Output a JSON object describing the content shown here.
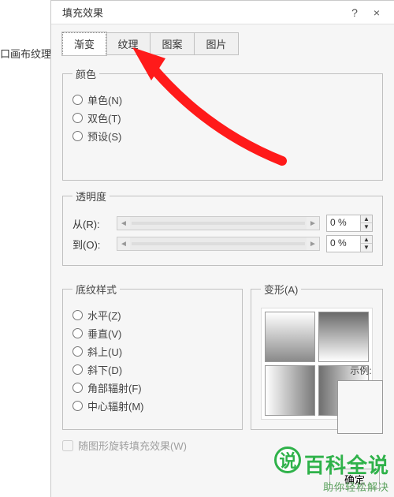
{
  "left_fragment": "口画布纹理的",
  "dialog": {
    "title": "填充效果",
    "help": "?",
    "close": "×"
  },
  "tabs": [
    "渐变",
    "纹理",
    "图案",
    "图片"
  ],
  "color": {
    "legend": "颜色",
    "one": "单色(N)",
    "two": "双色(T)",
    "preset": "预设(S)"
  },
  "transparency": {
    "legend": "透明度",
    "from": "从(R):",
    "to": "到(O):",
    "from_pct": "0 %",
    "to_pct": "0 %"
  },
  "style": {
    "legend": "底纹样式",
    "h": "水平(Z)",
    "v": "垂直(V)",
    "du": "斜上(U)",
    "dd": "斜下(D)",
    "corner": "角部辐射(F)",
    "center": "中心辐射(M)"
  },
  "variant": {
    "legend": "变形(A)"
  },
  "sample": {
    "label": "示例:"
  },
  "rotate": {
    "label": "随图形旋转填充效果(W)"
  },
  "buttons": {
    "ok": "确定"
  },
  "watermark": {
    "char": "说",
    "big": "百科全说",
    "sub": "助你轻松解决"
  }
}
